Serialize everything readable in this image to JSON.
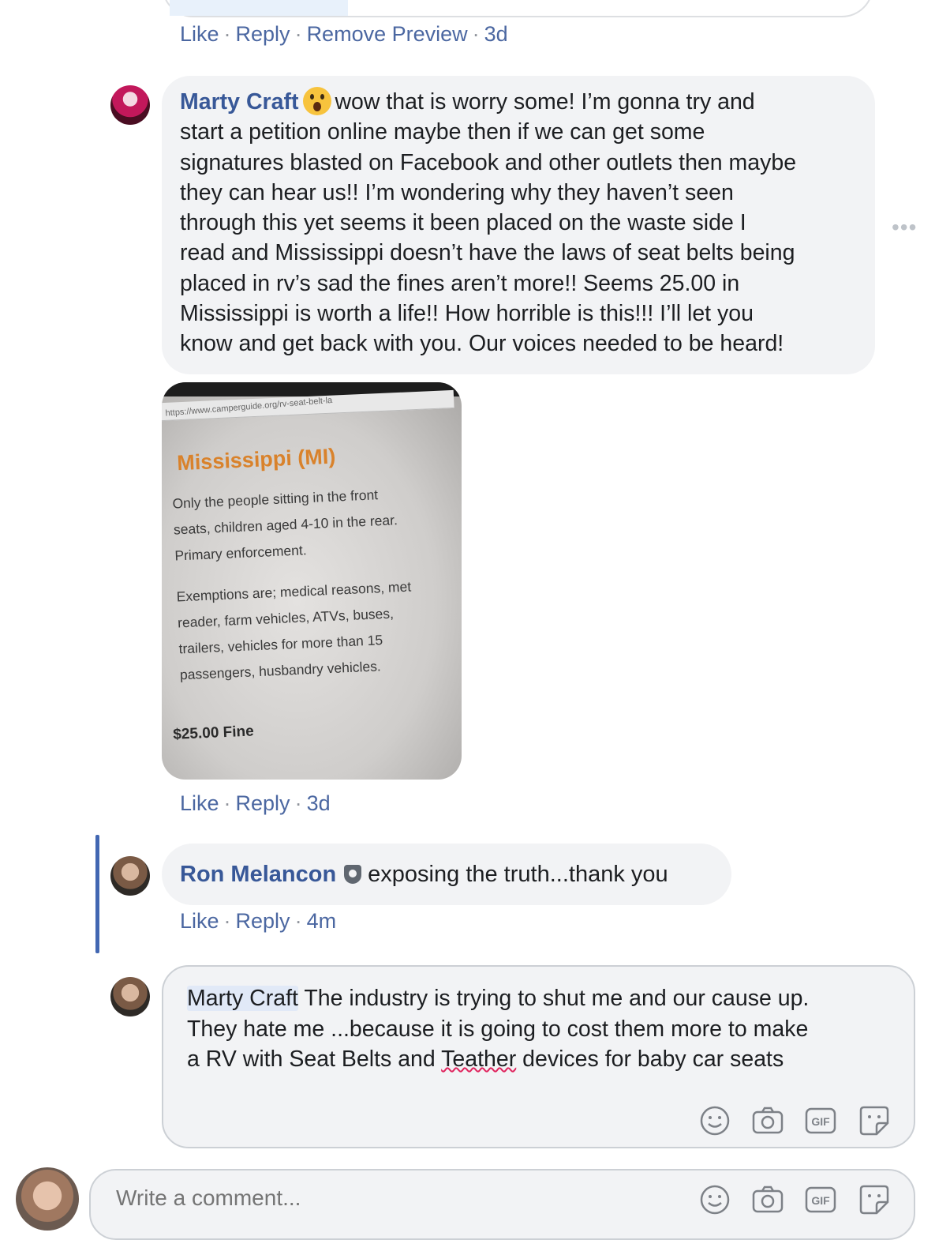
{
  "prev_comment": {
    "actions": [
      "Like",
      "Reply",
      "Remove Preview"
    ],
    "time": "3d"
  },
  "marty_comment": {
    "author": "Marty Craft",
    "emoji": "astonished-face-emoji",
    "lines": [
      "wow that is worry some! I’m gonna try and",
      "start a petition online maybe then if we can get some",
      "signatures blasted on Facebook and other outlets then maybe",
      "they can hear us!! I’m wondering why they haven’t seen",
      "through this yet seems it been placed on the waste side I",
      "read and Mississippi doesn’t have the laws of seat belts being",
      "placed in rv’s sad the fines aren’t more!! Seems 25.00 in",
      "Mississippi is worth a life!! How horrible is this!!! I’ll let you",
      "know and get back with you. Our voices needed to be heard!"
    ],
    "more_options": "•••",
    "photo": {
      "url": "https://www.camperguide.org/rv-seat-belt-la",
      "heading": "Mississippi (MI)",
      "para1": "Only the people sitting in the front\nseats, children aged 4-10 in the rear.\nPrimary enforcement.",
      "para2": "Exemptions are; medical reasons, met\nreader, farm vehicles, ATVs, buses,\ntrailers, vehicles for more than 15\npassengers, husbandry vehicles.",
      "fine": "$25.00 Fine"
    },
    "actions": [
      "Like",
      "Reply"
    ],
    "time": "3d"
  },
  "ron_comment": {
    "author": "Ron Melancon",
    "text": "exposing the truth...thank you",
    "actions": [
      "Like",
      "Reply"
    ],
    "time": "4m"
  },
  "reply_draft": {
    "mention": "Marty Craft",
    "text_line1": " The industry is trying to shut me and our cause up.",
    "text_line2": "They hate me ...because it is going to cost them more to make",
    "text_line3_a": "a RV with Seat Belts and ",
    "misspelled": "Teather",
    "text_line3_b": " devices for baby car seats",
    "tools": [
      "emoji-icon",
      "camera-icon",
      "gif-icon",
      "sticker-icon"
    ]
  },
  "new_comment": {
    "placeholder": "Write a comment...",
    "tools": [
      "emoji-icon",
      "camera-icon",
      "gif-icon",
      "sticker-icon"
    ]
  },
  "colors": {
    "link": "#4b67a1",
    "author": "#385898",
    "bubble": "#f2f3f5",
    "accent_bar": "#4267b2"
  }
}
